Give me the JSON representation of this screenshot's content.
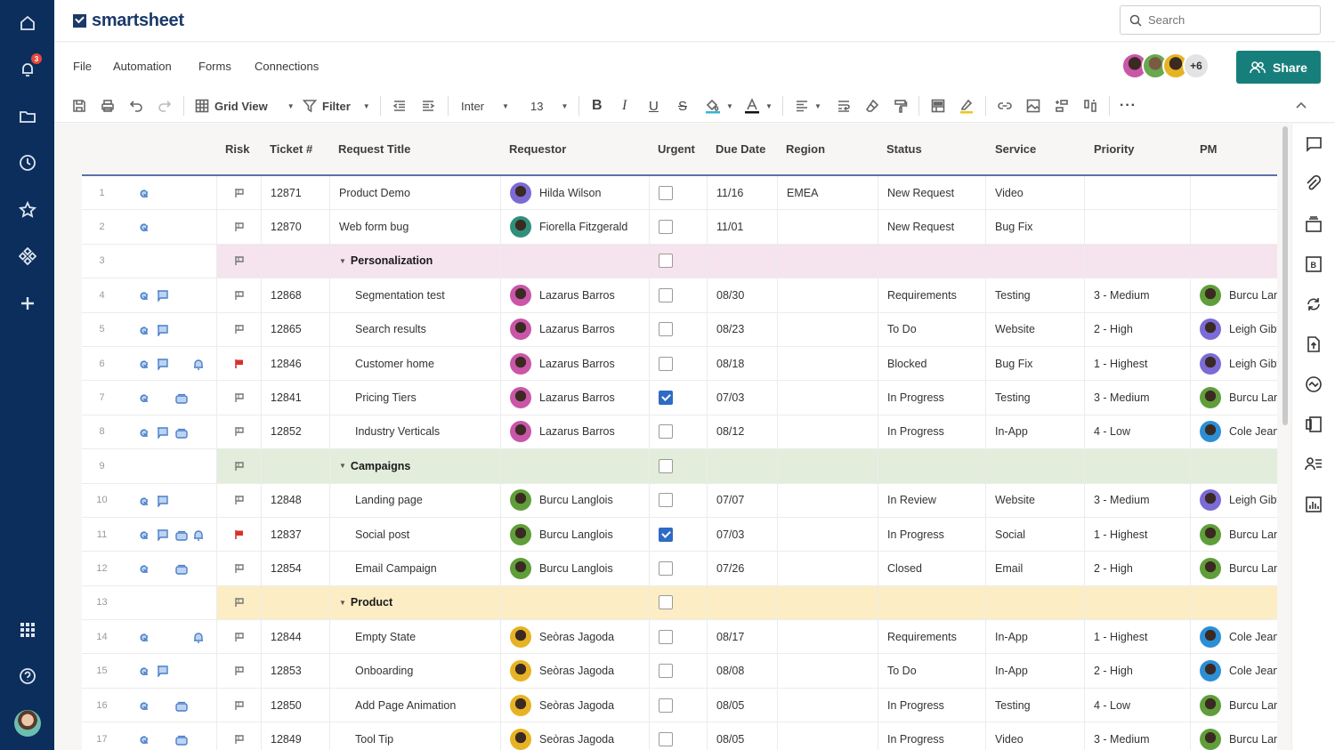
{
  "app": {
    "logo_text": "smartsheet",
    "notifications_count": "3"
  },
  "search": {
    "placeholder": "Search"
  },
  "menu": [
    "File",
    "Automation",
    "Forms",
    "Connections"
  ],
  "collaborators": {
    "more_label": "+6",
    "avatar_colors": [
      "#c956a8",
      "#6aa84f",
      "#e6b325"
    ]
  },
  "share_label": "Share",
  "toolbar": {
    "view_label": "Grid View",
    "filter_label": "Filter",
    "font_label": "Inter",
    "font_size": "13",
    "fill_color": "#33b5d6",
    "text_color": "#111111",
    "highlight_color": "#f0c419"
  },
  "columns": [
    "Risk",
    "Ticket #",
    "Request Title",
    "Requestor",
    "Urgent",
    "Due Date",
    "Region",
    "Status",
    "Service",
    "Priority",
    "PM"
  ],
  "people_colors": {
    "Hilda Wilson": "#7a6bd6",
    "Fiorella Fitzgerald": "#2f8f7a",
    "Lazarus Barros": "#c956a8",
    "Burcu Langlois": "#5f9e3a",
    "Seòras Jagoda": "#e6b325",
    "Leigh Gibt": "#7a6bd6",
    "Burcu Lan": "#5f9e3a",
    "Cole Jean": "#2c8fd6"
  },
  "rows": [
    {
      "num": "1",
      "icons": [
        "attach"
      ],
      "flag": "grey",
      "ticket": "12871",
      "title": "Product Demo",
      "requestor": "Hilda Wilson",
      "urgent": false,
      "due": "11/16",
      "region": "EMEA",
      "status": "New Request",
      "service": "Video",
      "priority": "",
      "pm": ""
    },
    {
      "num": "2",
      "icons": [
        "attach"
      ],
      "flag": "grey",
      "ticket": "12870",
      "title": "Web form bug",
      "requestor": "Fiorella Fitzgerald",
      "urgent": false,
      "due": "11/01",
      "region": "",
      "status": "New Request",
      "service": "Bug Fix",
      "priority": "",
      "pm": ""
    },
    {
      "num": "3",
      "group": true,
      "tint": "#f5e3ee",
      "title": "Personalization"
    },
    {
      "num": "4",
      "icons": [
        "attach",
        "comment"
      ],
      "flag": "grey",
      "ticket": "12868",
      "title": "Segmentation test",
      "requestor": "Lazarus Barros",
      "urgent": false,
      "due": "08/30",
      "region": "",
      "status": "Requirements",
      "service": "Testing",
      "priority": "3 - Medium",
      "pm": "Burcu Lan",
      "child": true
    },
    {
      "num": "5",
      "icons": [
        "attach",
        "comment"
      ],
      "flag": "grey",
      "ticket": "12865",
      "title": "Search results",
      "requestor": "Lazarus Barros",
      "urgent": false,
      "due": "08/23",
      "region": "",
      "status": "To Do",
      "service": "Website",
      "priority": "2 - High",
      "pm": "Leigh Gibt",
      "child": true
    },
    {
      "num": "6",
      "icons": [
        "attach",
        "comment",
        "",
        "reminder"
      ],
      "flag": "red",
      "ticket": "12846",
      "title": "Customer home",
      "requestor": "Lazarus Barros",
      "urgent": false,
      "due": "08/18",
      "region": "",
      "status": "Blocked",
      "service": "Bug Fix",
      "priority": "1 - Highest",
      "pm": "Leigh Gibt",
      "child": true
    },
    {
      "num": "7",
      "icons": [
        "attach",
        "",
        "proof"
      ],
      "flag": "grey",
      "ticket": "12841",
      "title": "Pricing Tiers",
      "requestor": "Lazarus Barros",
      "urgent": true,
      "due": "07/03",
      "region": "",
      "status": "In Progress",
      "service": "Testing",
      "priority": "3 - Medium",
      "pm": "Burcu Lan",
      "child": true
    },
    {
      "num": "8",
      "icons": [
        "attach",
        "comment",
        "proof"
      ],
      "flag": "grey",
      "ticket": "12852",
      "title": "Industry Verticals",
      "requestor": "Lazarus Barros",
      "urgent": false,
      "due": "08/12",
      "region": "",
      "status": "In Progress",
      "service": "In-App",
      "priority": "4 - Low",
      "pm": "Cole Jean",
      "child": true
    },
    {
      "num": "9",
      "group": true,
      "tint": "#e2eddb",
      "title": "Campaigns"
    },
    {
      "num": "10",
      "icons": [
        "attach",
        "comment"
      ],
      "flag": "grey",
      "ticket": "12848",
      "title": "Landing page",
      "requestor": "Burcu Langlois",
      "urgent": false,
      "due": "07/07",
      "region": "",
      "status": "In Review",
      "service": "Website",
      "priority": "3 - Medium",
      "pm": "Leigh Gibt",
      "child": true
    },
    {
      "num": "11",
      "icons": [
        "attach",
        "comment",
        "proof",
        "reminder"
      ],
      "flag": "red",
      "ticket": "12837",
      "title": "Social post",
      "requestor": "Burcu Langlois",
      "urgent": true,
      "due": "07/03",
      "region": "",
      "status": "In Progress",
      "service": "Social",
      "priority": "1 - Highest",
      "pm": "Burcu Lan",
      "child": true
    },
    {
      "num": "12",
      "icons": [
        "attach",
        "",
        "proof"
      ],
      "flag": "grey",
      "ticket": "12854",
      "title": "Email Campaign",
      "requestor": "Burcu Langlois",
      "urgent": false,
      "due": "07/26",
      "region": "",
      "status": "Closed",
      "service": "Email",
      "priority": "2 - High",
      "pm": "Burcu Lan",
      "child": true
    },
    {
      "num": "13",
      "group": true,
      "tint": "#fcedc5",
      "title": "Product"
    },
    {
      "num": "14",
      "icons": [
        "attach",
        "",
        "",
        "reminder"
      ],
      "flag": "grey",
      "ticket": "12844",
      "title": "Empty State",
      "requestor": "Seòras Jagoda",
      "urgent": false,
      "due": "08/17",
      "region": "",
      "status": "Requirements",
      "service": "In-App",
      "priority": "1 - Highest",
      "pm": "Cole Jean",
      "child": true
    },
    {
      "num": "15",
      "icons": [
        "attach",
        "comment"
      ],
      "flag": "grey",
      "ticket": "12853",
      "title": "Onboarding",
      "requestor": "Seòras Jagoda",
      "urgent": false,
      "due": "08/08",
      "region": "",
      "status": "To Do",
      "service": "In-App",
      "priority": "2 - High",
      "pm": "Cole Jean",
      "child": true
    },
    {
      "num": "16",
      "icons": [
        "attach",
        "",
        "proof"
      ],
      "flag": "grey",
      "ticket": "12850",
      "title": "Add Page Animation",
      "requestor": "Seòras Jagoda",
      "urgent": false,
      "due": "08/05",
      "region": "",
      "status": "In Progress",
      "service": "Testing",
      "priority": "4 - Low",
      "pm": "Burcu Lan",
      "child": true
    },
    {
      "num": "17",
      "icons": [
        "attach",
        "",
        "proof"
      ],
      "flag": "grey",
      "ticket": "12849",
      "title": "Tool Tip",
      "requestor": "Seòras Jagoda",
      "urgent": false,
      "due": "08/05",
      "region": "",
      "status": "In Progress",
      "service": "Video",
      "priority": "3 - Medium",
      "pm": "Burcu Lan",
      "child": true
    }
  ]
}
